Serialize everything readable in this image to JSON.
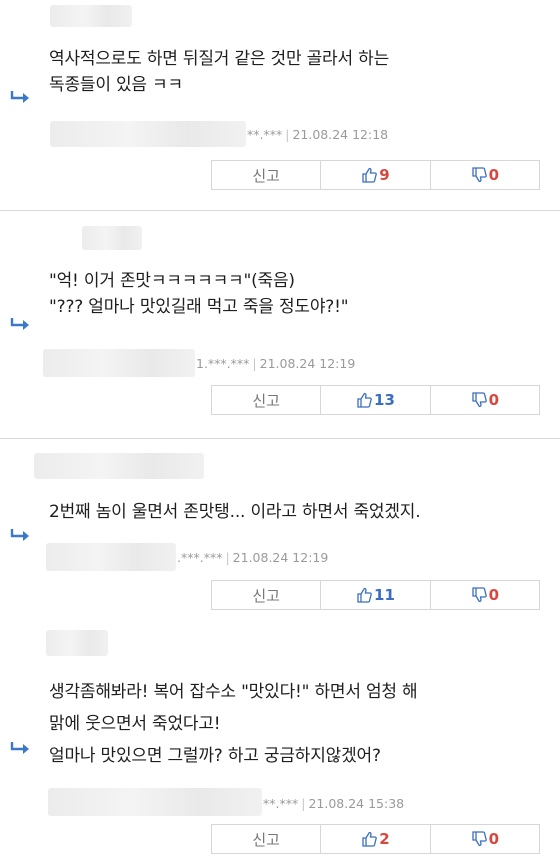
{
  "report_label": "신고",
  "comments": [
    {
      "lines": [
        "역사적으로도 하면 뒤질거 같은 것만 골라서 하는",
        "독종들이 있음 ㅋㅋ"
      ],
      "ip": "**.***",
      "date": "21.08.24 12:18",
      "likes": "9",
      "dislikes": "0"
    },
    {
      "lines": [
        "\"억! 이거 존맛ㅋㅋㅋㅋㅋㅋ\"(죽음)",
        "\"??? 얼마나 맛있길래 먹고 죽을 정도야?!\""
      ],
      "ip": "1.***.***",
      "date": "21.08.24 12:19",
      "likes": "13",
      "dislikes": "0"
    },
    {
      "lines": [
        "2번째 놈이 울면서 존맛탱... 이라고 하면서 죽었겠지."
      ],
      "ip": ".***.***",
      "date": "21.08.24 12:19",
      "likes": "11",
      "dislikes": "0"
    },
    {
      "lines": [
        "생각좀해봐라! 복어 잡수소 \"맛있다!\" 하면서 엄청 해",
        "맑에 웃으면서 죽었다고!",
        "얼마나 맛있으면 그럴까? 하고 궁금하지않겠어?"
      ],
      "ip": "**.***",
      "date": "21.08.24 15:38",
      "likes": "2",
      "dislikes": "0"
    }
  ],
  "colors": {
    "like_highlight": "#3a6ec0",
    "count_red": "#d9473f",
    "reply_arrow": "#3b78c9"
  },
  "icons": [
    "reply-arrow-icon",
    "thumbs-up-icon",
    "thumbs-down-icon"
  ]
}
